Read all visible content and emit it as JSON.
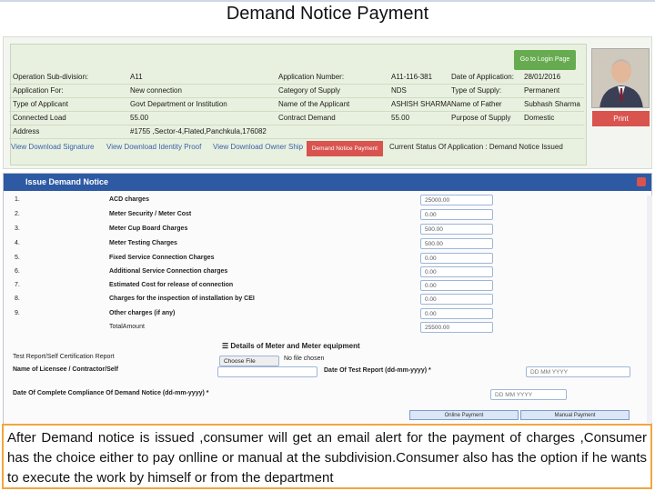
{
  "title": "Demand Notice Payment",
  "panel": {
    "login_button": "Go to Login Page",
    "print_button": "Print",
    "rows": [
      [
        {
          "k": "Operation Sub-division:",
          "v": "A11"
        },
        {
          "k": "Application Number:",
          "v": "A11-116-381"
        },
        {
          "k": "Date of Application:",
          "v": "28/01/2016"
        }
      ],
      [
        {
          "k": "Application For:",
          "v": "New connection"
        },
        {
          "k": "Category of Supply",
          "v": "NDS"
        },
        {
          "k": "Type of Supply:",
          "v": "Permanent"
        }
      ],
      [
        {
          "k": "Type of Applicant",
          "v": "Govt Department or Institution"
        },
        {
          "k": "Name of the Applicant",
          "v": "ASHISH SHARMA"
        },
        {
          "k": "Name of Father",
          "v": "Subhash Sharma"
        }
      ],
      [
        {
          "k": "Connected Load",
          "v": "55.00"
        },
        {
          "k": "Contract Demand",
          "v": "55.00"
        },
        {
          "k": "Purpose of Supply",
          "v": "Domestic"
        }
      ]
    ],
    "address_label": "Address",
    "address_value": "#1755 ,Sector-4,Flated,Panchkula,176082",
    "links": [
      "View Download Signature",
      "View Download Identity Proof",
      "View Download Owner Ship"
    ],
    "demand_button": "Demand Notice Payment",
    "status": "Current Status Of Application : Demand Notice Issued"
  },
  "form": {
    "header": "Issue Demand Notice",
    "rows": [
      {
        "sn": "1.",
        "label": "ACD charges",
        "value": "25000.00"
      },
      {
        "sn": "2.",
        "label": "Meter Security / Meter Cost",
        "value": "0.00"
      },
      {
        "sn": "3.",
        "label": "Meter Cup Board Charges",
        "value": "500.00"
      },
      {
        "sn": "4.",
        "label": "Meter Testing Charges",
        "value": "500.00"
      },
      {
        "sn": "5.",
        "label": "Fixed Service Connection Charges",
        "value": "0.00"
      },
      {
        "sn": "6.",
        "label": "Additional Service Connection charges",
        "value": "0.00"
      },
      {
        "sn": "7.",
        "label": "Estimated Cost for release of connection",
        "value": "0.00"
      },
      {
        "sn": "8.",
        "label": "Charges for the inspection of installation by CEI",
        "value": "0.00"
      },
      {
        "sn": "9.",
        "label": "Other charges (if any)",
        "value": "0.00"
      }
    ],
    "total_label": "TotalAmount",
    "total_value": "25500.00",
    "meter_section": "Details of Meter and Meter equipment",
    "test_report_label": "Test Report/Self Certification Report",
    "choose_file": "Choose File",
    "no_file": "No file chosen",
    "licensee_label": "Name of Licensee / Contractor/Self",
    "test_date_label": "Date Of Test Report (dd-mm-yyyy) *",
    "date_placeholder": "DD MM YYYY",
    "compliance_label": "Date Of Complete Compliance Of Demand Notice (dd-mm-yyyy) *",
    "btn_left": "Online Payment",
    "btn_right": "Manual Payment"
  },
  "caption": "After Demand notice is issued ,consumer will get an email alert for the payment of charges ,Consumer has the choice either to pay onlline or manual at the subdivision.Consumer also has the option if he wants to execute the work by himself or from the department"
}
